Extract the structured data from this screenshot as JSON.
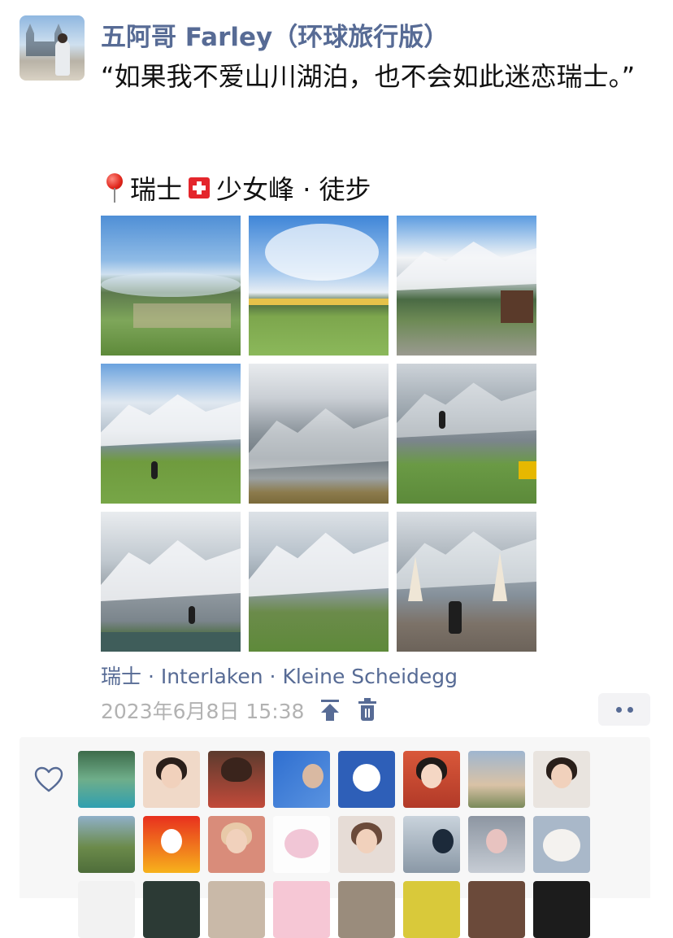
{
  "post": {
    "author": "五阿哥 Farley（环球旅行版）",
    "content": "“如果我不爱山川湖泊，也不会如此迷恋瑞士。”",
    "tagline": {
      "pin_icon": "round-pushpin-icon",
      "place": "瑞士",
      "flag_icon": "swiss-flag-icon",
      "activity": "少女峰 · 徒步"
    },
    "photo_count": 9,
    "location": "瑞士 · Interlaken · Kleine Scheidegg",
    "timestamp": "2023年6月8日 15:38",
    "icons": {
      "pin_top": "pin-to-top-icon",
      "delete": "trash-icon",
      "more": "more-dots-icon"
    }
  },
  "likes": {
    "icon": "heart-outline-icon",
    "avatar_rows_visible": 3,
    "avatars_per_row": 8
  },
  "colors": {
    "link_blue": "#576b95",
    "text": "#111111",
    "timestamp_gray": "#b2b2b2",
    "likes_bg": "#f7f7f7"
  }
}
